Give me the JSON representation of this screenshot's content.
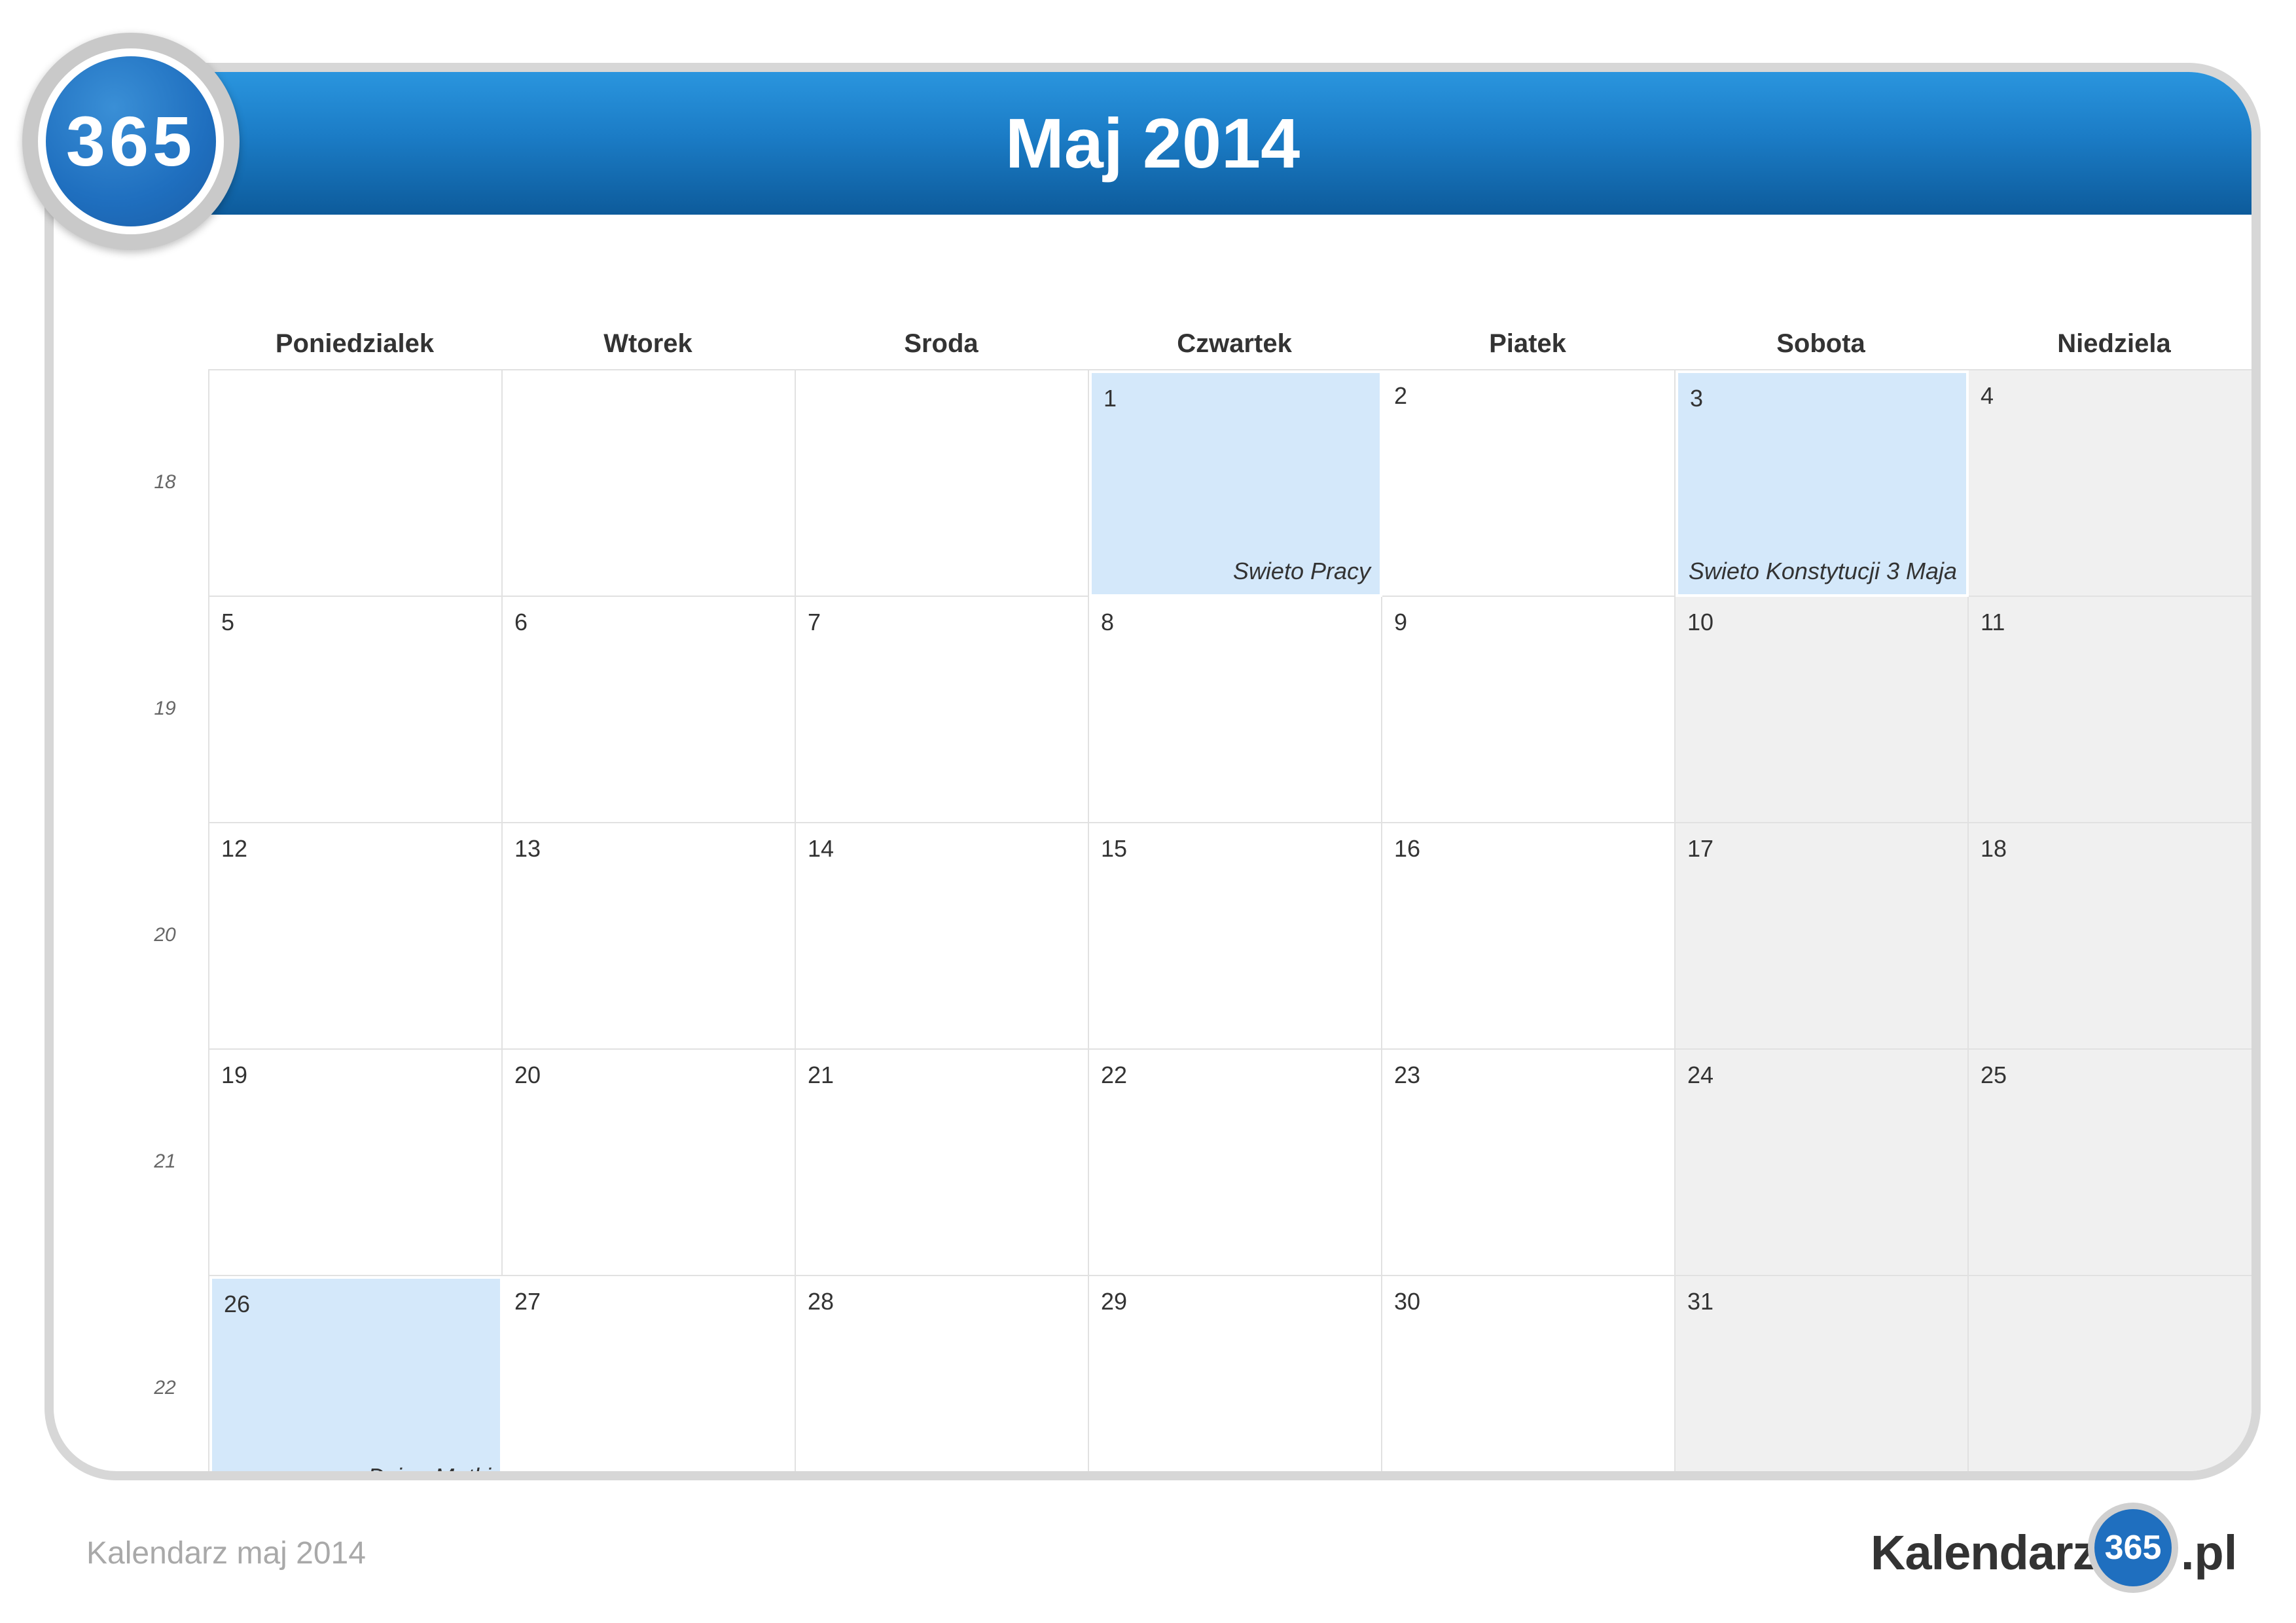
{
  "badge": {
    "label": "365"
  },
  "header": {
    "title": "Maj 2014"
  },
  "weekdays": [
    "Poniedzialek",
    "Wtorek",
    "Sroda",
    "Czwartek",
    "Piatek",
    "Sobota",
    "Niedziela"
  ],
  "week_numbers": [
    "18",
    "19",
    "20",
    "21",
    "22"
  ],
  "weeks": [
    [
      {
        "day": "",
        "holiday": ""
      },
      {
        "day": "",
        "holiday": ""
      },
      {
        "day": "",
        "holiday": ""
      },
      {
        "day": "1",
        "holiday": "Swieto Pracy"
      },
      {
        "day": "2",
        "holiday": ""
      },
      {
        "day": "3",
        "holiday": "Swieto Konstytucji 3 Maja"
      },
      {
        "day": "4",
        "holiday": ""
      }
    ],
    [
      {
        "day": "5",
        "holiday": ""
      },
      {
        "day": "6",
        "holiday": ""
      },
      {
        "day": "7",
        "holiday": ""
      },
      {
        "day": "8",
        "holiday": ""
      },
      {
        "day": "9",
        "holiday": ""
      },
      {
        "day": "10",
        "holiday": ""
      },
      {
        "day": "11",
        "holiday": ""
      }
    ],
    [
      {
        "day": "12",
        "holiday": ""
      },
      {
        "day": "13",
        "holiday": ""
      },
      {
        "day": "14",
        "holiday": ""
      },
      {
        "day": "15",
        "holiday": ""
      },
      {
        "day": "16",
        "holiday": ""
      },
      {
        "day": "17",
        "holiday": ""
      },
      {
        "day": "18",
        "holiday": ""
      }
    ],
    [
      {
        "day": "19",
        "holiday": ""
      },
      {
        "day": "20",
        "holiday": ""
      },
      {
        "day": "21",
        "holiday": ""
      },
      {
        "day": "22",
        "holiday": ""
      },
      {
        "day": "23",
        "holiday": ""
      },
      {
        "day": "24",
        "holiday": ""
      },
      {
        "day": "25",
        "holiday": ""
      }
    ],
    [
      {
        "day": "26",
        "holiday": "Dzien Matki"
      },
      {
        "day": "27",
        "holiday": ""
      },
      {
        "day": "28",
        "holiday": ""
      },
      {
        "day": "29",
        "holiday": ""
      },
      {
        "day": "30",
        "holiday": ""
      },
      {
        "day": "31",
        "holiday": ""
      },
      {
        "day": "",
        "holiday": ""
      }
    ]
  ],
  "footer": {
    "caption": "Kalendarz maj 2014",
    "logo_left": "Kalendarz-",
    "logo_number": "365",
    "logo_right": ".pl"
  },
  "colors": {
    "header_blue": "#1b7cc6",
    "holiday_fill": "#d4e8fa",
    "weekend_fill": "#f0f0f0"
  }
}
